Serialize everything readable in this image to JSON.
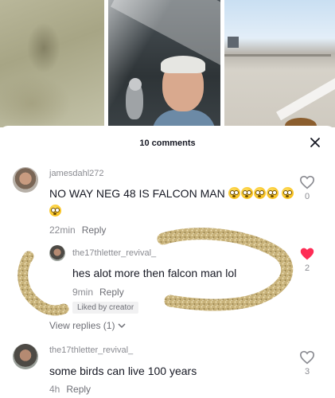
{
  "sheet": {
    "title": "10 comments",
    "close_icon": "close-icon"
  },
  "comments": [
    {
      "username": "jamesdahl272",
      "text": "NO WAY NEG 48 IS FALCON MAN",
      "time": "22min",
      "reply_label": "Reply",
      "likes": "0",
      "liked": false
    },
    {
      "username": "the17thletter_revival_",
      "text": "hes alot more then falcon man lol",
      "time": "9min",
      "reply_label": "Reply",
      "badge": "Liked by creator",
      "likes": "2",
      "liked": true
    },
    {
      "username": "the17thletter_revival_",
      "text": "some birds can live 100 years",
      "time": "4h",
      "reply_label": "Reply",
      "likes": "3",
      "liked": false
    }
  ],
  "view_replies": "View replies (1)",
  "colors": {
    "heart_liked": "#fe2c55",
    "muted_text": "#8a8b91",
    "primary_text": "#161823"
  }
}
